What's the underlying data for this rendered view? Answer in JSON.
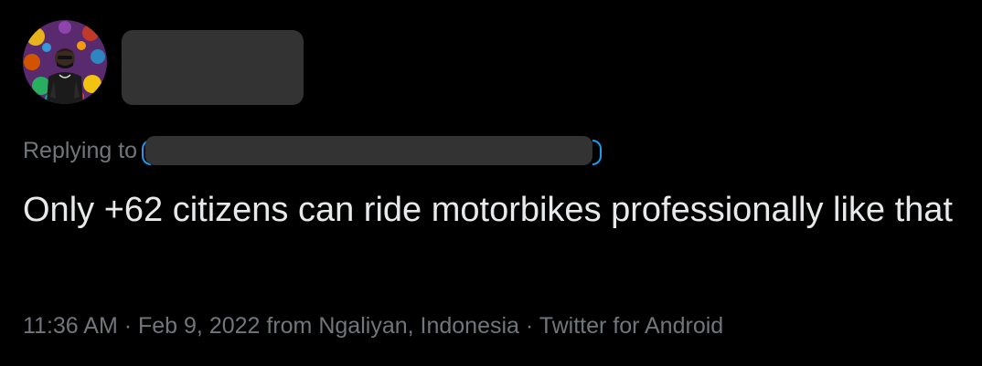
{
  "tweet": {
    "reply_prefix": "Replying to",
    "text": "Only +62 citizens can ride motorbikes professionally like that",
    "time": "11:36 AM",
    "separator": " · ",
    "date": "Feb 9, 2022",
    "from_prefix": " from ",
    "location": "Ngaliyan, Indonesia",
    "source": "Twitter for Android"
  },
  "colors": {
    "background": "#000000",
    "text_primary": "#e7e9ea",
    "text_secondary": "#71767b",
    "accent": "#1d9bf0",
    "redaction": "#333333"
  }
}
